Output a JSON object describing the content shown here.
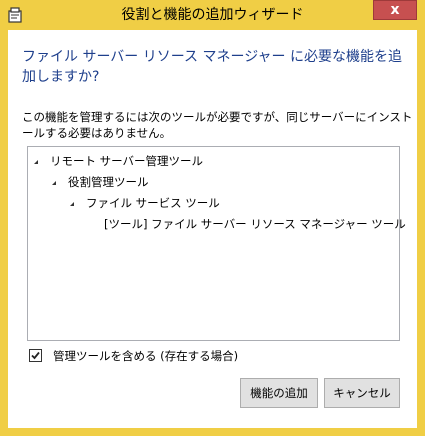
{
  "window": {
    "title": "役割と機能の追加ウィザード",
    "close_label": "x",
    "frame_color": "#f0ce45",
    "close_color": "#c75050"
  },
  "dialog": {
    "heading": "ファイル サーバー リソース マネージャー に必要な機能を追加しますか?",
    "description": "この機能を管理するには次のツールが必要ですが、同じサーバーにインストールする必要はありません。",
    "heading_color": "#1e3f8c"
  },
  "tree": {
    "items": [
      {
        "label": "リモート サーバー管理ツール",
        "expanded": true
      },
      {
        "label": "役割管理ツール",
        "expanded": true
      },
      {
        "label": "ファイル サービス ツール",
        "expanded": true
      },
      {
        "label": "[ツール] ファイル サーバー リソース マネージャー ツール",
        "expanded": false
      }
    ]
  },
  "options": {
    "include_tools_label": "管理ツールを含める (存在する場合)",
    "include_tools_checked": true
  },
  "buttons": {
    "add_features_label": "機能の追加",
    "cancel_label": "キャンセル"
  },
  "icons": {
    "app": "wizard-app-icon",
    "close": "close-icon",
    "expand": "expanded-triangle-icon",
    "check": "checkmark-icon"
  }
}
